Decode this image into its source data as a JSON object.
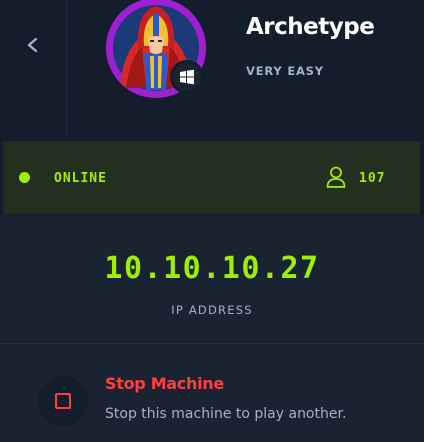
{
  "machine": {
    "name": "Archetype",
    "difficulty": "VERY EASY",
    "os_icon": "windows-icon",
    "avatar_icon": "warrior-avatar"
  },
  "navigation": {
    "back_icon": "chevron-left-icon"
  },
  "status": {
    "state": "ONLINE",
    "users_icon": "user-icon",
    "user_count": "107"
  },
  "network": {
    "ip": "10.10.10.27",
    "ip_label": "IP ADDRESS"
  },
  "actions": {
    "stop_title": "Stop Machine",
    "stop_description": "Stop this machine to play another.",
    "stop_icon": "stop-square-icon"
  },
  "colors": {
    "background": "#141d2b",
    "panel": "#1a2332",
    "accent_green": "#9fef00",
    "danger_red": "#ff3e3e",
    "muted_text": "#a4b1cd",
    "avatar_ring": "#9f1fd3"
  }
}
